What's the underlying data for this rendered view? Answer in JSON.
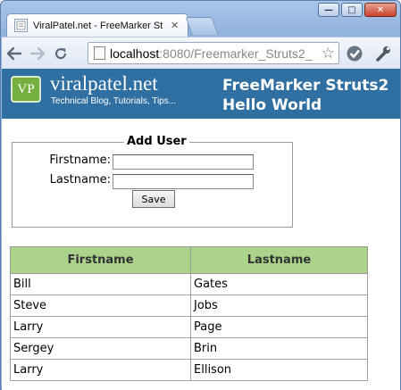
{
  "browser": {
    "tab_title": "ViralPatel.net - FreeMarker St",
    "url_host": "localhost",
    "url_path": ":8080/Freemarker_Struts2_",
    "tab_close": "✕"
  },
  "banner": {
    "logo_text": "VP",
    "site_name": "viralpatel.net",
    "tagline": "Technical Blog, Tutorials, Tips...",
    "title": "FreeMarker Struts2 Hello World"
  },
  "form": {
    "legend": "Add User",
    "firstname_label": "Firstname:",
    "lastname_label": "Lastname:",
    "firstname_value": "",
    "lastname_value": "",
    "save_label": "Save"
  },
  "table": {
    "headers": [
      "Firstname",
      "Lastname"
    ],
    "rows": [
      [
        "Bill",
        "Gates"
      ],
      [
        "Steve",
        "Jobs"
      ],
      [
        "Larry",
        "Page"
      ],
      [
        "Sergey",
        "Brin"
      ],
      [
        "Larry",
        "Ellison"
      ]
    ]
  },
  "colors": {
    "banner": "#2f6fa1",
    "table_header": "#acd38c",
    "logo": "#76b041"
  }
}
